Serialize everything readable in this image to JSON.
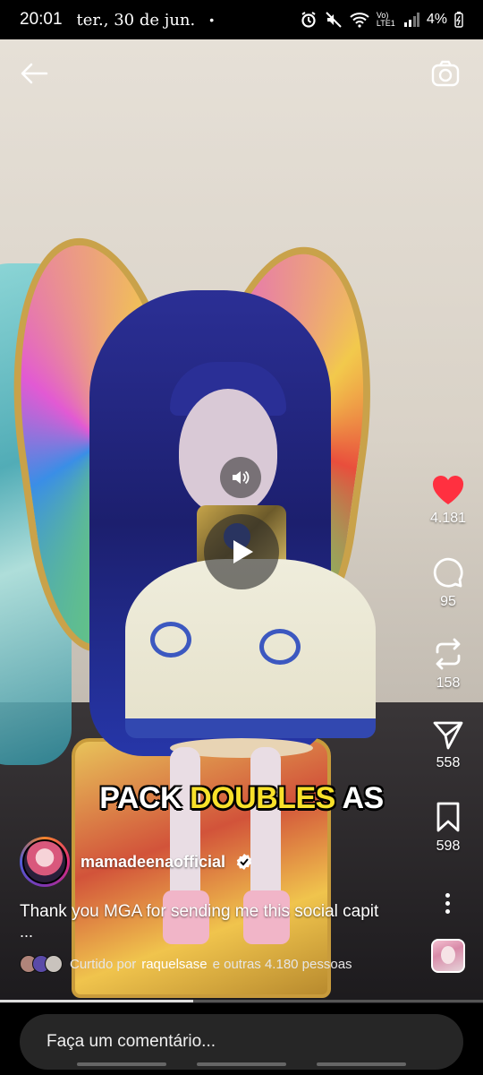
{
  "status_bar": {
    "time": "20:01",
    "date": "ter., 30 de jun.",
    "dot": "•",
    "network": "Vo) LTE1",
    "battery": "4%"
  },
  "video": {
    "overlay_caption": [
      "PACK",
      "DOUBLES",
      "AS"
    ],
    "progress_fraction": 0.4
  },
  "actions": {
    "likes": "4.181",
    "comments": "95",
    "reposts": "158",
    "shares": "558",
    "saves": "598"
  },
  "post": {
    "username": "mamadeenaofficial",
    "caption": "Thank you MGA for sending me this social capit",
    "caption_more": "...",
    "liked_prefix": "Curtido por",
    "liked_user": "raquelsase",
    "liked_suffix": "e outras 4.180 pessoas"
  },
  "comment_bar": {
    "placeholder": "Faça um comentário..."
  },
  "colors": {
    "like_red": "#ff3040",
    "caption_yellow": "#f8e12a"
  }
}
